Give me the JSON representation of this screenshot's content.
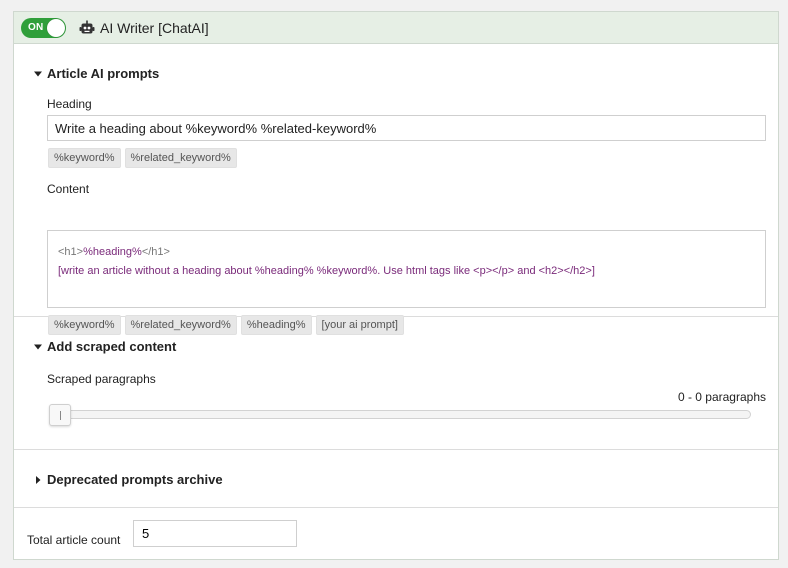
{
  "header": {
    "toggle_label": "ON",
    "toggle_state": "on",
    "robot_icon": "robot-icon",
    "title": "AI Writer [ChatAI]",
    "accent_color": "#2f9f3a",
    "header_bg": "#e6efe5"
  },
  "article_prompts": {
    "title": "Article AI prompts",
    "expanded": true,
    "heading_label": "Heading",
    "heading_value": "Write a heading about %keyword% %related-keyword%",
    "heading_tags": [
      "%keyword%",
      "%related_keyword%"
    ],
    "content_label": "Content",
    "content_line1": {
      "open_tag": "<h1>",
      "text": "%heading%",
      "close_tag": "</h1>"
    },
    "content_line2": "[write an article without a heading about %heading% %keyword%. Use html tags like <p></p> and <h2></h2>]",
    "content_tags": [
      "%keyword%",
      "%related_keyword%",
      "%heading%",
      "[your ai prompt]"
    ]
  },
  "scraped": {
    "title": "Add scraped content",
    "expanded": true,
    "slider_label": "Scraped paragraphs",
    "readout": "0 - 0 paragraphs",
    "slider_value": 0
  },
  "deprecated": {
    "title": "Deprecated prompts archive",
    "expanded": false
  },
  "footer": {
    "count_label": "Total article count",
    "count_value": "5"
  }
}
